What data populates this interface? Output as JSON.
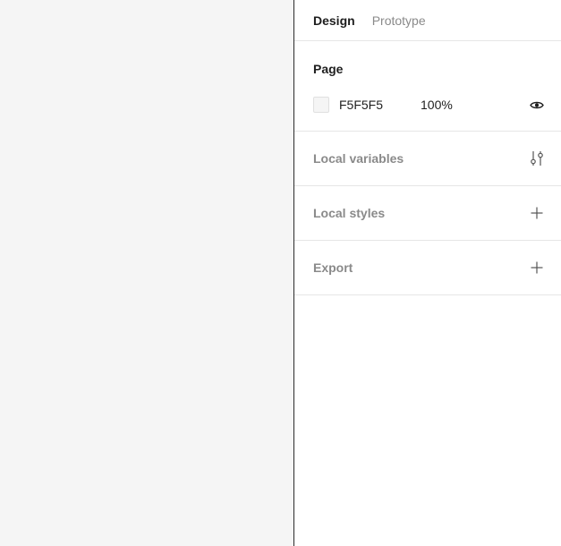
{
  "tabs": [
    {
      "label": "Design",
      "active": true
    },
    {
      "label": "Prototype",
      "active": false
    }
  ],
  "page_section": {
    "title": "Page",
    "fill": {
      "color": "#F5F5F5",
      "hex_label": "F5F5F5",
      "opacity": "100%",
      "visibility_icon": "eye-icon"
    }
  },
  "sections": {
    "local_variables": {
      "label": "Local variables",
      "icon": "adjust-sliders-icon"
    },
    "local_styles": {
      "label": "Local styles",
      "icon": "plus-icon"
    },
    "export": {
      "label": "Export",
      "icon": "plus-icon"
    }
  },
  "colors": {
    "canvas_background": "#F5F5F5",
    "panel_background": "#FFFFFF",
    "text_primary": "#1E1E1E",
    "text_secondary": "#8A8A8A",
    "divider": "#E6E6E6"
  }
}
